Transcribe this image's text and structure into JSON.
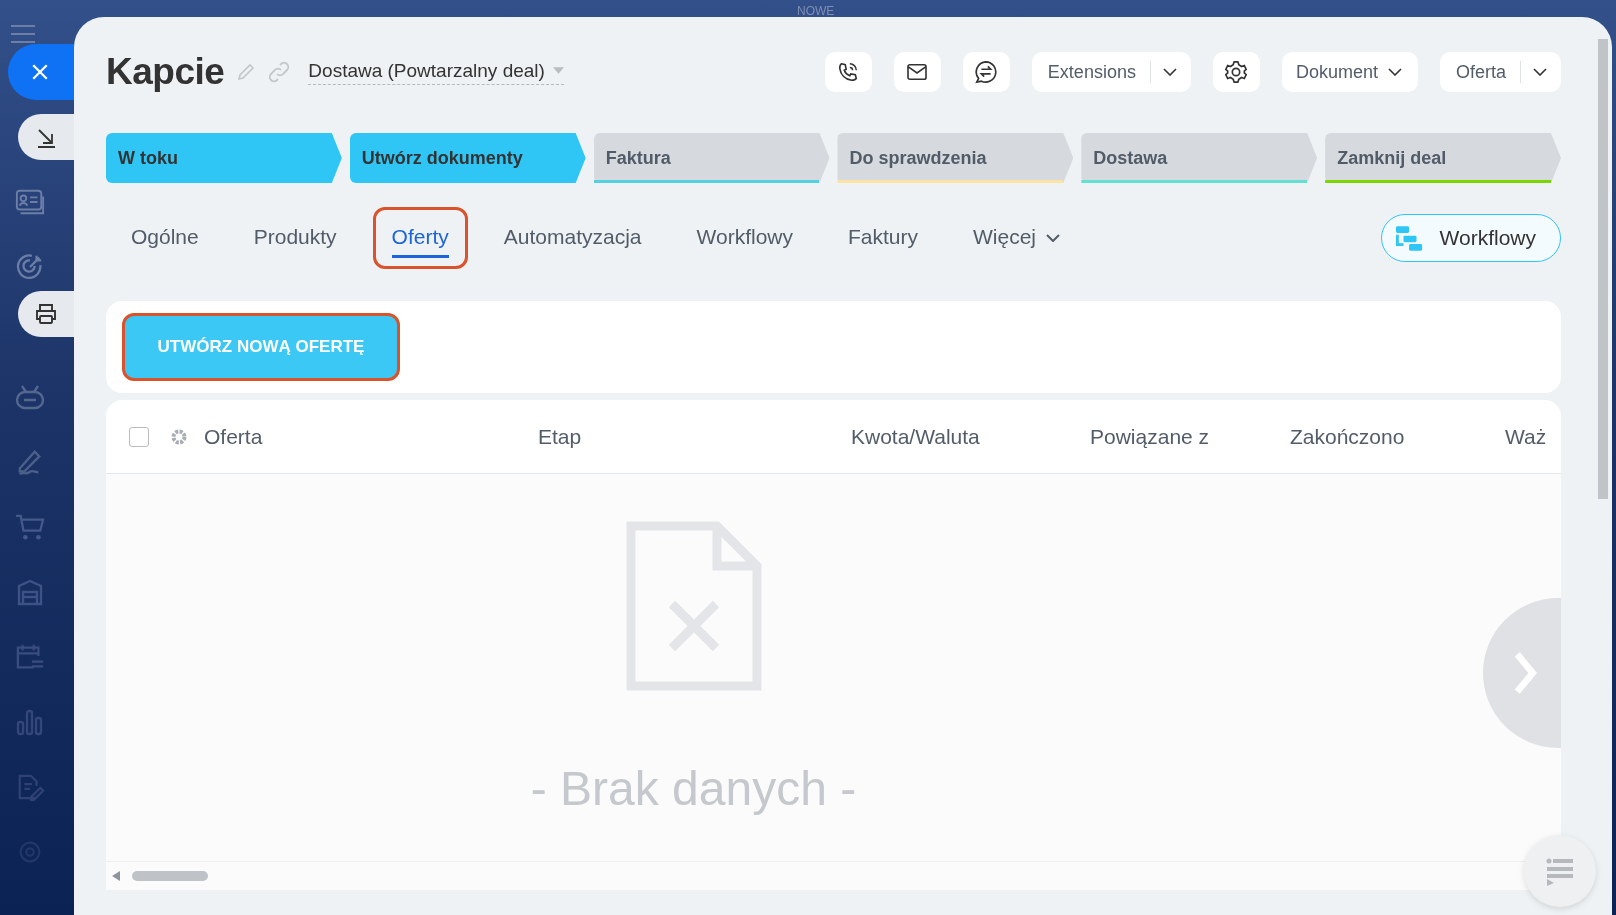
{
  "top_label": "NOWE",
  "title": "Kapcie",
  "pipeline": {
    "label": "Dostawa (Powtarzalny deal)"
  },
  "toolbar": [
    {
      "kind": "icon"
    },
    {
      "kind": "icon"
    },
    {
      "kind": "icon"
    },
    {
      "kind": "split",
      "label": "Extensions"
    },
    {
      "kind": "icon"
    },
    {
      "kind": "dropdown",
      "label": "Dokument"
    },
    {
      "kind": "split",
      "label": "Oferta"
    }
  ],
  "stages": [
    {
      "label": "W toku",
      "done": true,
      "color": "#2fc6f6"
    },
    {
      "label": "Utwórz dokumenty",
      "done": true,
      "color": "#2fc6f6"
    },
    {
      "label": "Faktura",
      "done": false,
      "color": "#55d0e0"
    },
    {
      "label": "Do sprawdzenia",
      "done": false,
      "color": "#fae3a5"
    },
    {
      "label": "Dostawa",
      "done": false,
      "color": "#64e0d2"
    },
    {
      "label": "Zamknij deal",
      "done": false,
      "color": "#7bd500"
    }
  ],
  "tabs": [
    {
      "label": "Ogólne",
      "kind": "plain",
      "selected": false,
      "highlighted": false
    },
    {
      "label": "Produkty",
      "kind": "plain",
      "selected": false,
      "highlighted": false
    },
    {
      "label": "Oferty",
      "kind": "plain",
      "selected": true,
      "highlighted": true
    },
    {
      "label": "Automatyzacja",
      "kind": "plain",
      "selected": false,
      "highlighted": false
    },
    {
      "label": "Workflowy",
      "kind": "plain",
      "selected": false,
      "highlighted": false
    },
    {
      "label": "Faktury",
      "kind": "plain",
      "selected": false,
      "highlighted": false
    },
    {
      "label": "Więcej",
      "kind": "dropdown",
      "selected": false,
      "highlighted": false
    }
  ],
  "workflow_button": {
    "label": "Workflowy"
  },
  "create_button": {
    "label": "UTWÓRZ NOWĄ OFERTĘ",
    "highlighted": true
  },
  "table": {
    "select_all": {
      "checked": false
    },
    "columns": [
      "Oferta",
      "Etap",
      "Kwota/Waluta",
      "Powiązane z",
      "Zakończono",
      "Waż"
    ],
    "empty_text": "- Brak danych -"
  }
}
